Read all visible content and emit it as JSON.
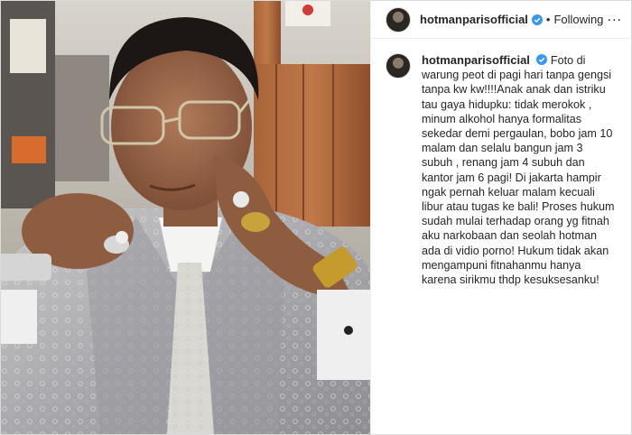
{
  "post": {
    "username": "hotmanparisofficial",
    "separator": "•",
    "follow_status": "Following",
    "more_label": "...",
    "caption": "Foto di warung peot di pagi hari tanpa gengsi tanpa kw kw!!!!Anak anak dan istriku tau gaya hidupku: tidak merokok , minum alkohol hanya formalitas sekedar demi pergaulan, bobo jam 10 malam dan selalu bangun jam 3 subuh , renang jam 4 subuh dan kantor jam 6 pagi! Di jakarta hampir ngak pernah keluar malam kecuali libur atau tugas ke bali! Proses hukum sudah mulai terhadap orang yg fitnah aku narkobaan dan seolah hotman ada di vidio porno! Hukum tidak akan mengampuni fitnahanmu hanya karena sirikmu thdp kesuksesanku!"
  },
  "icons": {
    "verified": "verified-badge-icon",
    "more": "more-options-icon"
  },
  "colors": {
    "verified_blue": "#3897f0",
    "text": "#262626",
    "border": "#dbdbdb"
  }
}
